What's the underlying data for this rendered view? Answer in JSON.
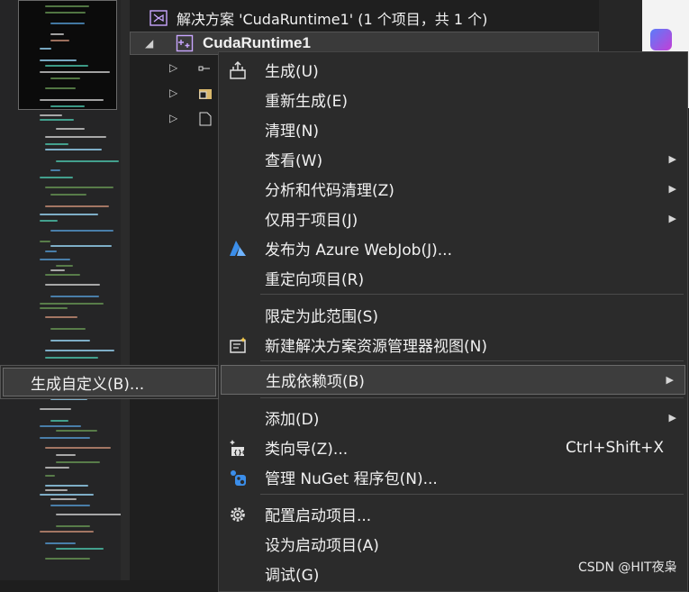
{
  "solution_explorer": {
    "solution_label": "解决方案 'CudaRuntime1' (1 个项目，共 1 个)",
    "project_label": "CudaRuntime1"
  },
  "context_menu": {
    "items": [
      {
        "label": "生成(U)",
        "icon": "build-icon",
        "submenu": false
      },
      {
        "label": "重新生成(E)",
        "icon": "",
        "submenu": false
      },
      {
        "label": "清理(N)",
        "icon": "",
        "submenu": false
      },
      {
        "label": "查看(W)",
        "icon": "",
        "submenu": true
      },
      {
        "label": "分析和代码清理(Z)",
        "icon": "",
        "submenu": true
      },
      {
        "label": "仅用于项目(J)",
        "icon": "",
        "submenu": true
      },
      {
        "label": "发布为 Azure WebJob(J)...",
        "icon": "azure-icon",
        "submenu": false
      },
      {
        "label": "重定向项目(R)",
        "icon": "",
        "submenu": false
      },
      {
        "label": "限定为此范围(S)",
        "icon": "",
        "submenu": false
      },
      {
        "label": "新建解决方案资源管理器视图(N)",
        "icon": "new-view-icon",
        "submenu": false
      },
      {
        "label": "生成依赖项(B)",
        "icon": "",
        "submenu": true
      },
      {
        "label": "添加(D)",
        "icon": "",
        "submenu": true
      },
      {
        "label": "类向导(Z)...",
        "icon": "class-wizard-icon",
        "submenu": false,
        "shortcut": "Ctrl+Shift+X"
      },
      {
        "label": "管理 NuGet 程序包(N)...",
        "icon": "nuget-icon",
        "submenu": false
      },
      {
        "label": "配置启动项目...",
        "icon": "gear-icon",
        "submenu": false
      },
      {
        "label": "设为启动项目(A)",
        "icon": "",
        "submenu": false
      },
      {
        "label": "调试(G)",
        "icon": "",
        "submenu": false
      }
    ]
  },
  "submenu": {
    "item_label": "生成自定义(B)..."
  },
  "watermark": "CSDN @HIT夜枭",
  "colors": {
    "menu_bg": "#2b2b2b",
    "highlight_bg": "#3d3d3d",
    "azure": "#3b8eea",
    "editor_bg": "#1e1e1e"
  }
}
